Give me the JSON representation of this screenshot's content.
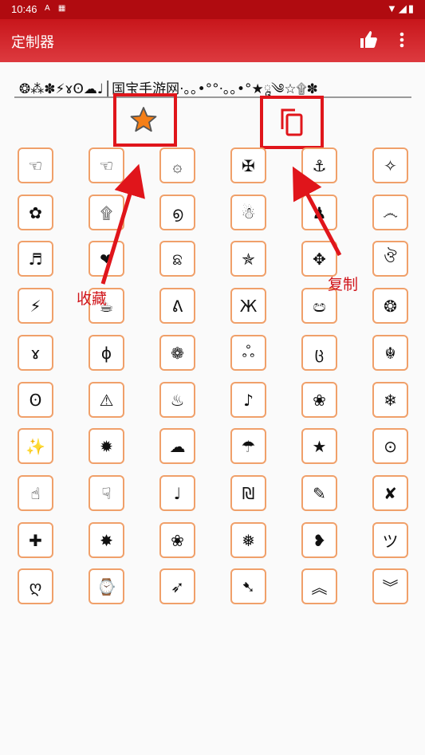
{
  "status": {
    "time": "10:46",
    "notif_icons": "A ▦",
    "right_icons": "▼◢▮"
  },
  "appbar": {
    "title": "定制器"
  },
  "input": {
    "text": "❂⁂✽⚡ɤʘ☁♩│国宝手游网·｡｡•°°·｡｡•°★ཱ༄☆۩✽"
  },
  "symbols": [
    "☜",
    "☜",
    "۞",
    "✠",
    "⚓",
    "✧",
    "✿",
    "۩",
    "൭",
    "☃",
    "♟",
    "෴",
    "♬",
    "❤",
    "ଛ",
    "✯",
    "✥",
    "ঔ",
    "⚡",
    "☕",
    "ᕕ",
    "Ж",
    "ඏ",
    "❂",
    "ɤ",
    "ɸ",
    "❁",
    "ஃ",
    "ც",
    "☬",
    "ʘ",
    "⚠",
    "♨",
    "♪",
    "❀",
    "❄",
    "✨",
    "✹",
    "☁",
    "☂",
    "★",
    "⊙",
    "☝",
    "☟",
    "♩",
    "₪",
    "✎",
    "✘",
    "✚",
    "✸",
    "❀",
    "❅",
    "❥",
    "ツ",
    "ღ",
    "⌚",
    "➶",
    "➷",
    "︽",
    "︾"
  ],
  "annotations": {
    "favorite": "收藏",
    "copy": "复制"
  },
  "colors": {
    "accent": "#c8161b",
    "cell_border": "#f0a06a",
    "annotation": "#e0151b"
  }
}
